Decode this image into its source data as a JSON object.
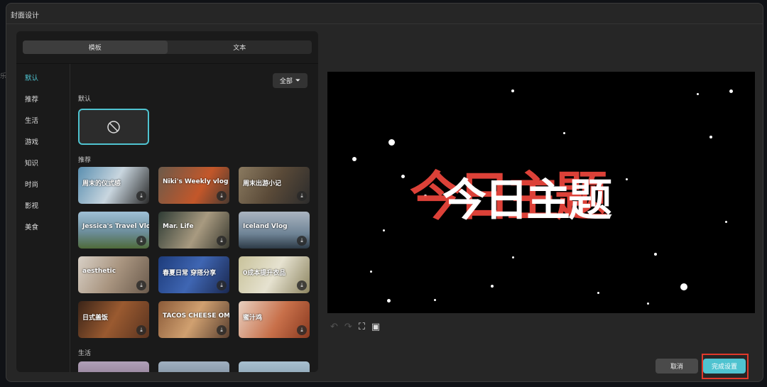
{
  "dialog": {
    "title": "封面设计"
  },
  "tabs": [
    {
      "label": "模板",
      "active": true
    },
    {
      "label": "文本",
      "active": false
    }
  ],
  "sidebar": {
    "items": [
      "默认",
      "推荐",
      "生活",
      "游戏",
      "知识",
      "时尚",
      "影视",
      "美食"
    ],
    "active": "默认"
  },
  "filter": {
    "label": "全部"
  },
  "sections": {
    "default": "默认",
    "recommend": "推荐",
    "life": "生活"
  },
  "templates": [
    {
      "title": "周末的仪式感",
      "bg": "linear-gradient(120deg,#5a8fb0,#c9d6df 50%,#2a2a2a)"
    },
    {
      "title": "Niki's Weekly vlog",
      "bg": "linear-gradient(120deg,#6b5a4a,#c3572a 60%,#4a3a30)"
    },
    {
      "title": "周末出游小记",
      "bg": "linear-gradient(120deg,#8a7a60,#5a4a38 50%,#2c2c2c)"
    },
    {
      "title": "Jessica's Travel Vlog",
      "bg": "linear-gradient(180deg,#9fc0d6,#6d8e9c 55%,#4f6b3a)"
    },
    {
      "title": "Mar. Life",
      "bg": "linear-gradient(120deg,#2e3b34,#a89a80 55%,#3a3a30)"
    },
    {
      "title": "Iceland Vlog",
      "bg": "linear-gradient(180deg,#aab4c0,#6f8496 60%,#2d3a46)"
    },
    {
      "title": "aesthetic",
      "bg": "linear-gradient(120deg,#d8d0c6,#a99580 50%,#6a5a4c)"
    },
    {
      "title": "春夏日常 穿搭分享",
      "bg": "linear-gradient(120deg,#1d3b7a,#3f66b3 50%,#1a2850)"
    },
    {
      "title": "0成本提升衣品",
      "bg": "linear-gradient(120deg,#c8c29a,#e6e2d0 50%,#8c8460)"
    },
    {
      "title": "日式盖饭",
      "bg": "linear-gradient(120deg,#3a2418,#9a5a30 50%,#5a3420)"
    },
    {
      "title": "TACOS CHEESE OMELETTE",
      "bg": "linear-gradient(120deg,#8a5a38,#d0a070 50%,#5a4030)"
    },
    {
      "title": "蜜汁鸡",
      "bg": "linear-gradient(120deg,#e8d0c0,#c8704a 55%,#8a3a20)"
    }
  ],
  "preview": {
    "headline": "今日主题"
  },
  "buttons": {
    "cancel": "取消",
    "confirm": "完成设置"
  },
  "colors": {
    "accent": "#4fc3d0",
    "headline_red": "#e8453c",
    "highlight": "#e0392b"
  }
}
